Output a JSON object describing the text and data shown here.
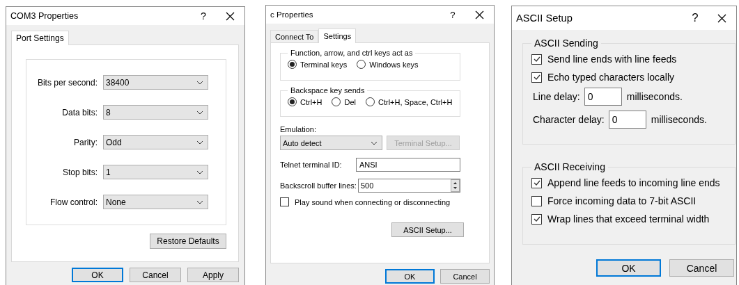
{
  "com_dialog": {
    "title": "COM3 Properties",
    "help": "?",
    "tabs": [
      {
        "label": "Port Settings",
        "selected": true
      }
    ],
    "fields": [
      {
        "label": "Bits per second:",
        "value": "38400"
      },
      {
        "label": "Data bits:",
        "value": "8"
      },
      {
        "label": "Parity:",
        "value": "Odd"
      },
      {
        "label": "Stop bits:",
        "value": "1"
      },
      {
        "label": "Flow control:",
        "value": "None"
      }
    ],
    "restore_button": "Restore Defaults",
    "buttons": [
      {
        "label": "OK",
        "default": true
      },
      {
        "label": "Cancel",
        "default": false
      },
      {
        "label": "Apply",
        "default": false
      }
    ]
  },
  "terminal_dialog": {
    "title": "c Properties",
    "help": "?",
    "tabs": [
      {
        "label": "Connect To",
        "selected": false
      },
      {
        "label": "Settings",
        "selected": true
      }
    ],
    "groups": [
      {
        "legend": "Function, arrow, and ctrl keys act as",
        "options": [
          {
            "label": "Terminal keys",
            "selected": true
          },
          {
            "label": "Windows keys",
            "selected": false
          }
        ]
      },
      {
        "legend": "Backspace key sends",
        "options": [
          {
            "label": "Ctrl+H",
            "selected": true
          },
          {
            "label": "Del",
            "selected": false
          },
          {
            "label": "Ctrl+H, Space, Ctrl+H",
            "selected": false
          }
        ]
      }
    ],
    "emulation": {
      "label": "Emulation:",
      "value": "Auto detect"
    },
    "terminal_setup": {
      "label": "Terminal Setup...",
      "disabled": true
    },
    "telnet_id": {
      "label": "Telnet terminal ID:",
      "value": "ANSI"
    },
    "backscroll": {
      "label": "Backscroll buffer lines:",
      "value": "500"
    },
    "play_sound": {
      "label": "Play sound when connecting or disconnecting",
      "checked": false
    },
    "ascii_button": "ASCII Setup...",
    "buttons": [
      {
        "label": "OK",
        "default": true
      },
      {
        "label": "Cancel",
        "default": false
      }
    ]
  },
  "ascii_dialog": {
    "title": "ASCII Setup",
    "help": "?",
    "groups": [
      {
        "legend": "ASCII Sending",
        "items": [
          {
            "kind": "checkbox",
            "label": "Send line ends with line feeds",
            "checked": true
          },
          {
            "kind": "checkbox",
            "label": "Echo typed characters locally",
            "checked": true
          },
          {
            "kind": "delay",
            "label": "Line delay:",
            "value": "0",
            "unit": "milliseconds."
          },
          {
            "kind": "delay",
            "label": "Character delay:",
            "value": "0",
            "unit": "milliseconds."
          }
        ]
      },
      {
        "legend": "ASCII Receiving",
        "items": [
          {
            "kind": "checkbox",
            "label": "Append line feeds to incoming line ends",
            "checked": true
          },
          {
            "kind": "checkbox",
            "label": "Force incoming data to 7-bit ASCII",
            "checked": false
          },
          {
            "kind": "checkbox",
            "label": "Wrap lines that exceed terminal width",
            "checked": true
          }
        ]
      }
    ],
    "buttons": [
      {
        "label": "OK",
        "default": true
      },
      {
        "label": "Cancel",
        "default": false
      }
    ]
  }
}
